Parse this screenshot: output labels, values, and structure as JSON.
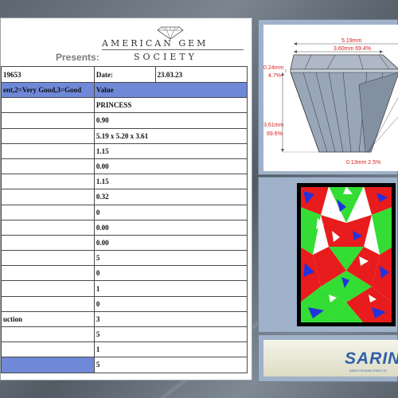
{
  "header": {
    "org_line1": "AMERICAN GEM",
    "org_line2": "SOCIETY",
    "presents": "Presents:"
  },
  "table": {
    "info_row": {
      "id": "19653",
      "date_label": "Date:",
      "date_value": "23.03.23"
    },
    "head_row": {
      "label": "ent,2=Very Good,3=Good",
      "value": "Value"
    },
    "rows": [
      {
        "label": "",
        "value": "PRINCESS"
      },
      {
        "label": "",
        "value": "0.90"
      },
      {
        "label": "",
        "value": "5.19 x 5.20 x 3.61"
      },
      {
        "label": "",
        "value": "1.15"
      },
      {
        "label": "",
        "value": "0.00"
      },
      {
        "label": "",
        "value": "1.15"
      },
      {
        "label": "",
        "value": "0.32"
      },
      {
        "label": "",
        "value": "0"
      },
      {
        "label": "",
        "value": "0.00"
      },
      {
        "label": "",
        "value": "0.00"
      },
      {
        "label": "",
        "value": "5"
      },
      {
        "label": "",
        "value": "0"
      },
      {
        "label": "",
        "value": "1"
      },
      {
        "label": "",
        "value": "0"
      },
      {
        "label": "uction",
        "value": "3"
      },
      {
        "label": "",
        "value": "5"
      },
      {
        "label": "",
        "value": "1"
      },
      {
        "label": "",
        "value": "5"
      }
    ]
  },
  "diagram": {
    "width_top": "5.19mm",
    "table_width": "3.60mm 69.4%",
    "crown_height": "0.24mm",
    "crown_pct": "4.7%",
    "depth": "3.61mm",
    "depth_pct": "69.6%",
    "culet": "0.13mm 2.5%"
  },
  "logo": {
    "brand": "SARIN",
    "tagline": "SARIN TECHNOLOGIES LTD"
  },
  "colors": {
    "table_header": "#6f88d8",
    "dimension_red": "#d82020",
    "map_green": "#33dd33",
    "map_red": "#e81c1c",
    "map_blue": "#2233dd",
    "brand_blue": "#2f5fa8"
  }
}
